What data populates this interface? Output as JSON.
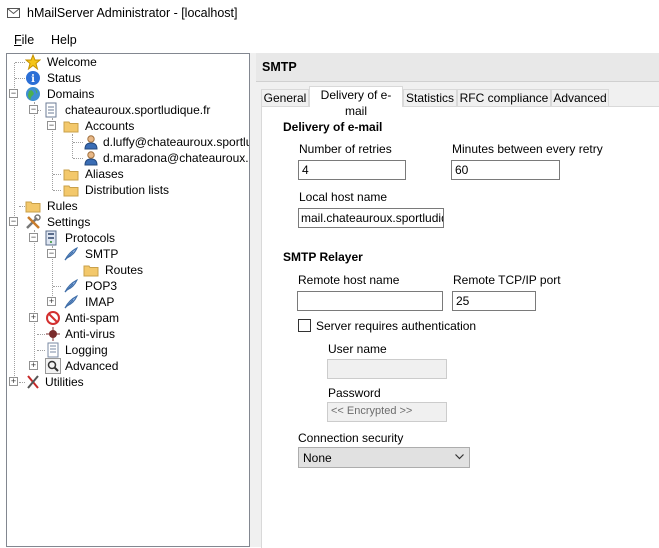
{
  "window": {
    "title": "hMailServer Administrator - [localhost]"
  },
  "menu": [
    {
      "label": "File",
      "accel": "F",
      "rest": "ile"
    },
    {
      "label": "Help"
    }
  ],
  "tree": {
    "welcome": "Welcome",
    "status": "Status",
    "domains": "Domains",
    "domain": "chateauroux.sportludique.fr",
    "accounts": "Accounts",
    "account1": "d.luffy@chateauroux.sportludiq",
    "account2": "d.maradona@chateauroux.spo",
    "aliases": "Aliases",
    "distribution_lists": "Distribution lists",
    "rules": "Rules",
    "settings": "Settings",
    "protocols": "Protocols",
    "smtp": "SMTP",
    "routes": "Routes",
    "pop3": "POP3",
    "imap": "IMAP",
    "antispam": "Anti-spam",
    "antivirus": "Anti-virus",
    "logging": "Logging",
    "advanced": "Advanced",
    "utilities": "Utilities"
  },
  "panel": {
    "title": "SMTP",
    "tabs": [
      "General",
      "Delivery of e-mail",
      "Statistics",
      "RFC compliance",
      "Advanced"
    ],
    "active_tab": "Delivery of e-mail"
  },
  "delivery": {
    "heading": "Delivery of e-mail",
    "retries_label": "Number of retries",
    "retries_value": "4",
    "minutes_label": "Minutes between every retry",
    "minutes_value": "60",
    "hostname_label": "Local host name",
    "hostname_value": "mail.chateauroux.sportludique"
  },
  "relayer": {
    "heading": "SMTP Relayer",
    "remote_host_label": "Remote host name",
    "remote_host_value": "",
    "remote_port_label": "Remote TCP/IP port",
    "remote_port_value": "25",
    "auth_label": "Server requires authentication",
    "auth_checked": false,
    "username_label": "User name",
    "username_value": "",
    "password_label": "Password",
    "password_value": "<< Encrypted >>",
    "security_label": "Connection security",
    "security_value": "None"
  },
  "colors": {
    "tab_bg": "#f0f0f0",
    "panel_bg": "#ffffff",
    "header_bg": "#e8e8e8"
  }
}
